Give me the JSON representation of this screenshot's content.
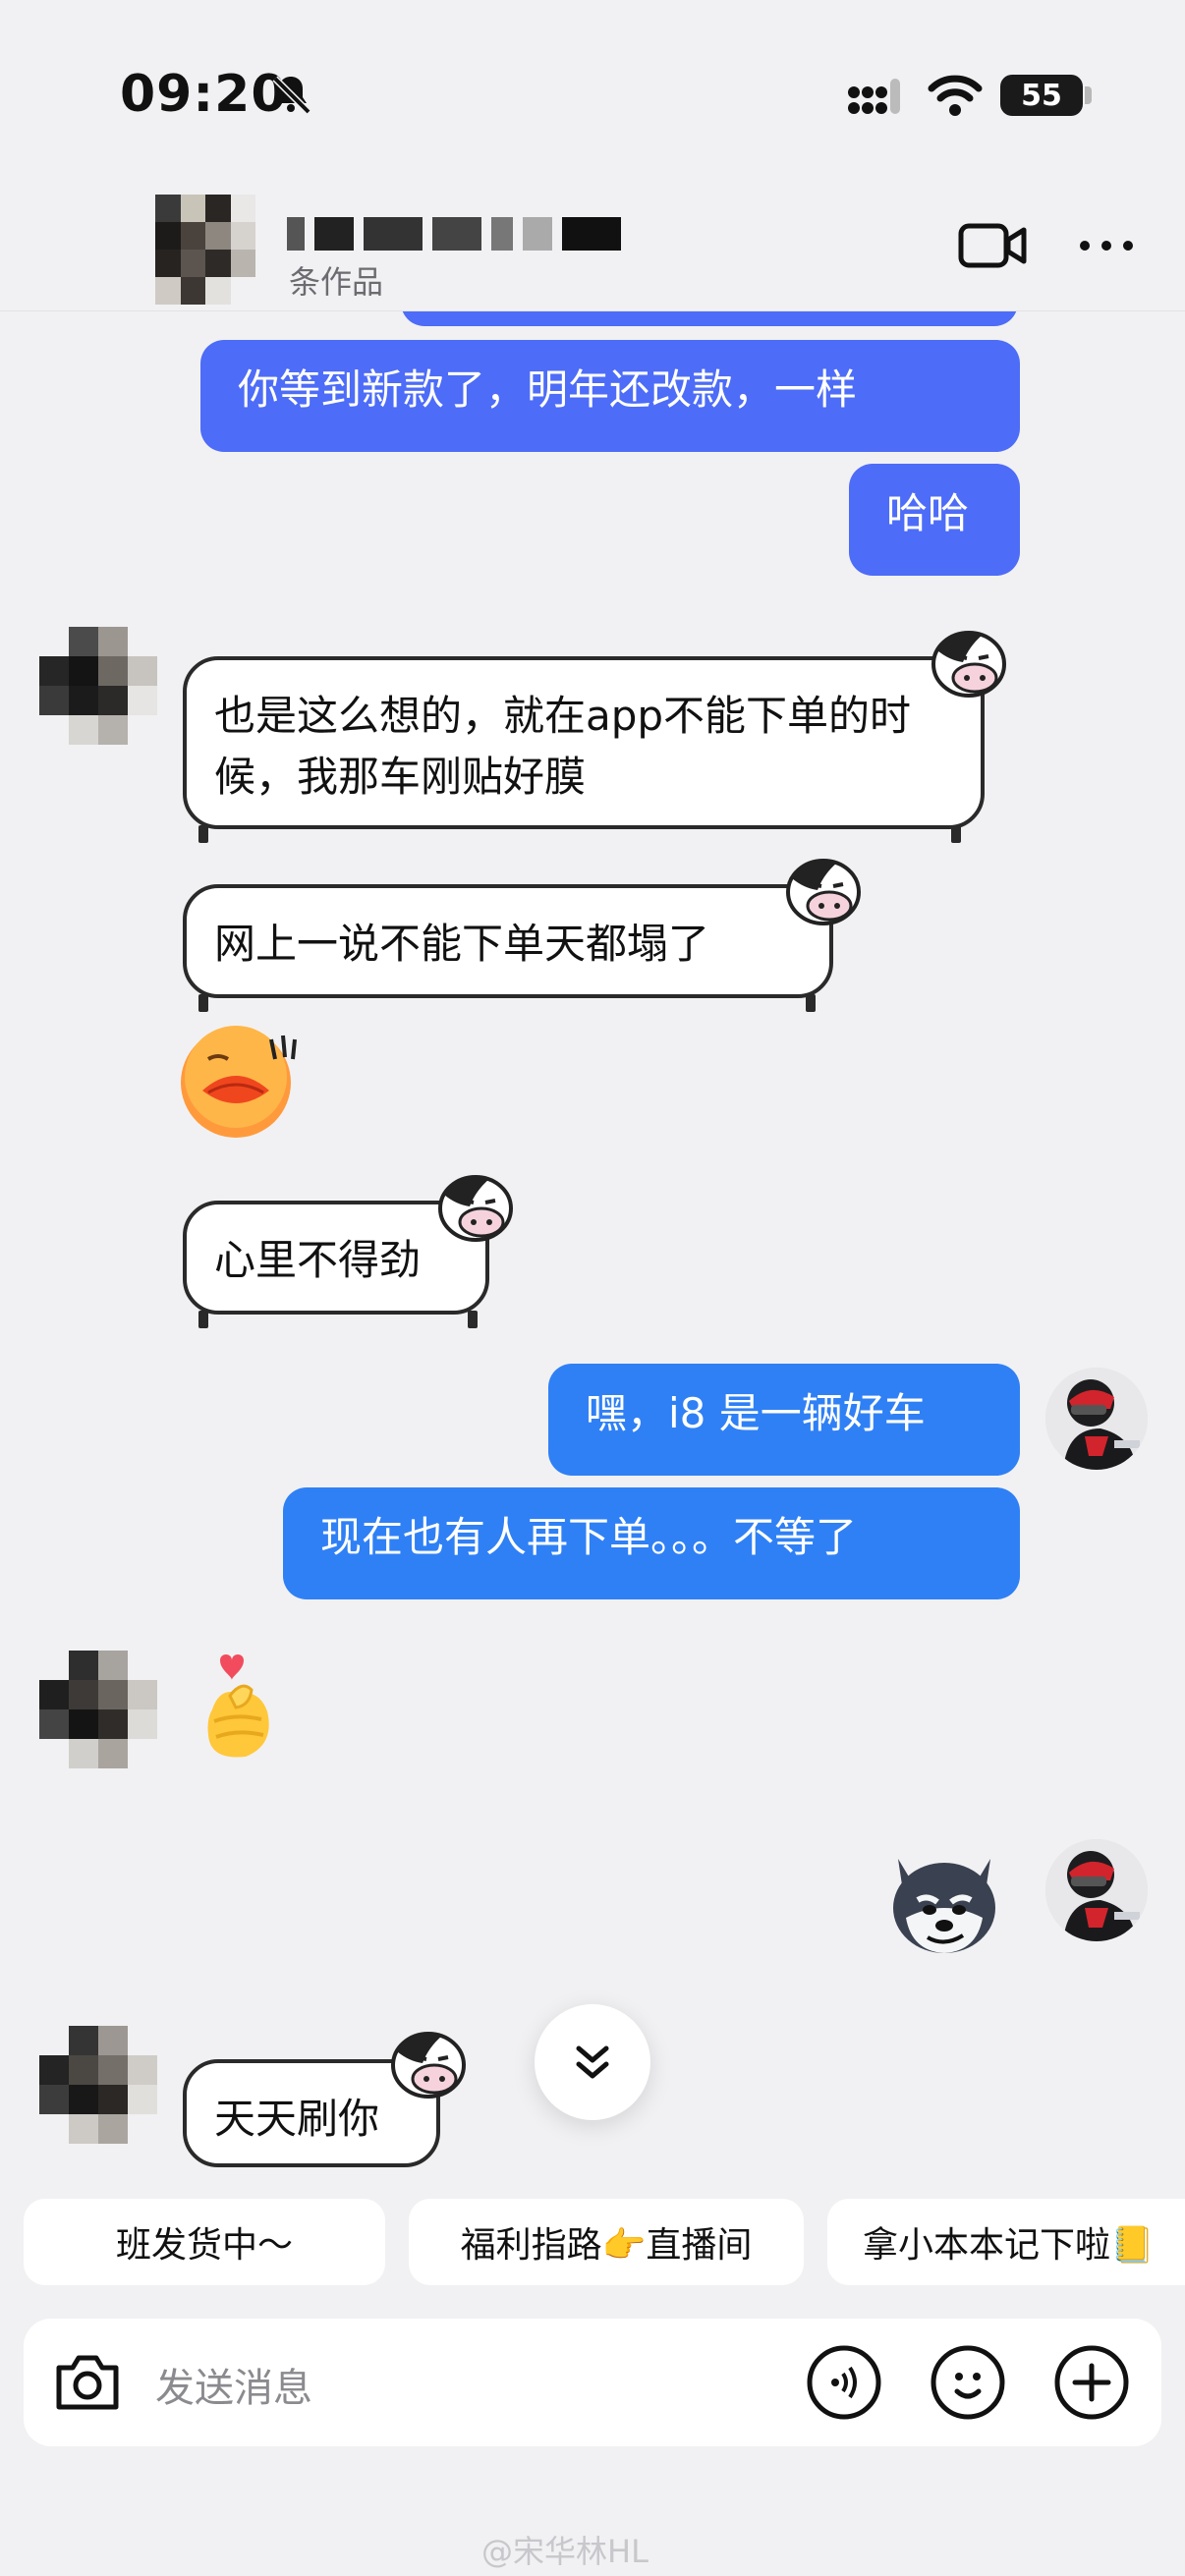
{
  "status_bar": {
    "time": "09:20",
    "battery": "55"
  },
  "header": {
    "subtitle": "条作品"
  },
  "messages": {
    "m1": "你等到新款了，明年还改款，一样",
    "m2": "哈哈",
    "m3": "也是这么想的，就在app不能下单的时候，我那车刚贴好膜",
    "m4": "网上一说不能下单天都塌了",
    "m5": "心里不得劲",
    "m6": "嘿，i8 是一辆好车",
    "m7": "现在也有人再下单。。。不等了",
    "m8": "天天刷你"
  },
  "quick_replies": [
    "班发货中～",
    "福利指路👉直播间",
    "拿小本本记下啦📒"
  ],
  "input": {
    "placeholder": "发送消息"
  },
  "watermark": "@宋华林HL",
  "colors": {
    "blue_bubble": "#4d6cf7",
    "azure_bubble": "#2f80f5",
    "background": "#f1f1f3"
  }
}
